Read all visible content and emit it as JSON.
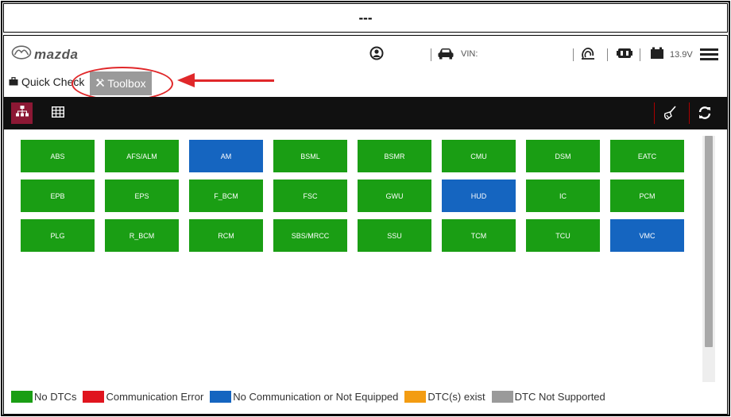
{
  "header": {
    "title": "---"
  },
  "topbar": {
    "logo_text": "mazda",
    "vin_label": "VIN:",
    "voltage": "13.9V"
  },
  "tabs": {
    "quick_check": "Quick Check",
    "toolbox": "Toolbox"
  },
  "modules": [
    {
      "label": "ABS",
      "status": "no_dtc"
    },
    {
      "label": "AFS/ALM",
      "status": "no_dtc"
    },
    {
      "label": "AM",
      "status": "no_comm"
    },
    {
      "label": "BSML",
      "status": "no_dtc"
    },
    {
      "label": "BSMR",
      "status": "no_dtc"
    },
    {
      "label": "CMU",
      "status": "no_dtc"
    },
    {
      "label": "DSM",
      "status": "no_dtc"
    },
    {
      "label": "EATC",
      "status": "no_dtc"
    },
    {
      "label": "EPB",
      "status": "no_dtc"
    },
    {
      "label": "EPS",
      "status": "no_dtc"
    },
    {
      "label": "F_BCM",
      "status": "no_dtc"
    },
    {
      "label": "FSC",
      "status": "no_dtc"
    },
    {
      "label": "GWU",
      "status": "no_dtc"
    },
    {
      "label": "HUD",
      "status": "no_comm"
    },
    {
      "label": "IC",
      "status": "no_dtc"
    },
    {
      "label": "PCM",
      "status": "no_dtc"
    },
    {
      "label": "PLG",
      "status": "no_dtc"
    },
    {
      "label": "R_BCM",
      "status": "no_dtc"
    },
    {
      "label": "RCM",
      "status": "no_dtc"
    },
    {
      "label": "SBS/MRCC",
      "status": "no_dtc"
    },
    {
      "label": "SSU",
      "status": "no_dtc"
    },
    {
      "label": "TCM",
      "status": "no_dtc"
    },
    {
      "label": "TCU",
      "status": "no_dtc"
    },
    {
      "label": "VMC",
      "status": "no_comm"
    }
  ],
  "status_colors": {
    "no_dtc": "#1a9e14",
    "comm_error": "#e0141e",
    "no_comm": "#1565c0",
    "dtc_exist": "#f39c12",
    "not_supported": "#9a9a9a"
  },
  "legend": [
    {
      "label": "No DTCs",
      "color": "#1a9e14"
    },
    {
      "label": "Communication Error",
      "color": "#e0141e"
    },
    {
      "label": "No Communication or Not Equipped",
      "color": "#1565c0"
    },
    {
      "label": "DTC(s) exist",
      "color": "#f39c12"
    },
    {
      "label": "DTC Not Supported",
      "color": "#9a9a9a"
    }
  ],
  "icons": {
    "logo": "mazda-logo-icon",
    "user": "user-icon",
    "car": "car-icon",
    "satellite": "satellite-icon",
    "vci": "vci-icon",
    "battery": "battery-icon",
    "menu": "menu-icon",
    "toolbox": "wrench-icon",
    "tree_view": "tree-view-icon",
    "table_view": "table-view-icon",
    "clear": "broom-icon",
    "refresh": "refresh-icon"
  },
  "annotation_color": "#e0282a"
}
